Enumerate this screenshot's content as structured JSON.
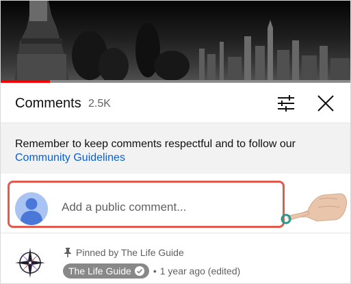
{
  "video": {
    "progress_fraction": 0.14,
    "progress_color": "#ff0000"
  },
  "header": {
    "title": "Comments",
    "count": "2.5K",
    "filter_icon": "sliders-icon",
    "close_icon": "close-icon"
  },
  "notice": {
    "text": "Remember to keep comments respectful and to follow our",
    "link": "Community Guidelines",
    "link_color": "#065fd4"
  },
  "add_comment": {
    "placeholder": "Add a public comment...",
    "avatar_icon": "person-avatar-icon",
    "highlight_color": "#e05a4e"
  },
  "pinned_comment": {
    "pinned_text": "Pinned by The Life Guide",
    "author": "The Life Guide",
    "time": "1 year ago (edited)",
    "separator": "•",
    "pin_icon": "pin-icon",
    "verified_icon": "verified-check-icon"
  }
}
